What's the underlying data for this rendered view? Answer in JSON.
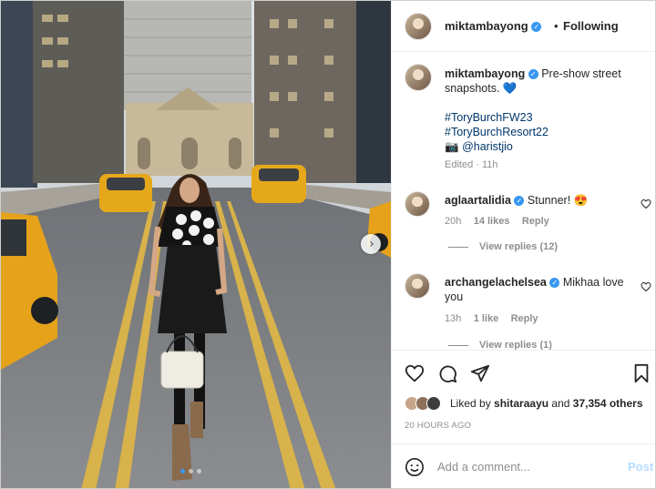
{
  "post": {
    "username": "miktambayong",
    "follow_status": "Following",
    "separator": "•",
    "caption": {
      "text": "Pre-show street snapshots. 💙",
      "hashtags": [
        "#ToryBurchFW23",
        "#ToryBurchResort22"
      ],
      "credit_prefix": "📷",
      "credit": "@haristjio",
      "edited": "Edited · 11h"
    },
    "comments": [
      {
        "username": "aglaartalidia",
        "text": "Stunner! 😍",
        "age": "20h",
        "likes": "14 likes",
        "reply_label": "Reply",
        "view_replies": "View replies (12)"
      },
      {
        "username": "archangelachelsea",
        "text": "Mikhaa love you",
        "age": "13h",
        "likes": "1 like",
        "reply_label": "Reply",
        "view_replies": "View replies (1)"
      }
    ],
    "likes_summary": {
      "prefix": "Liked by",
      "user": "shitaraayu",
      "middle": "and",
      "count": "37,354 others"
    },
    "time_ago": "20 HOURS AGO",
    "add_comment_placeholder": "Add a comment...",
    "post_button": "Post"
  },
  "icons": {
    "verified": "verified-badge-icon",
    "heart": "heart-icon",
    "comment": "comment-icon",
    "share": "share-icon",
    "save": "bookmark-icon",
    "emoji": "emoji-icon",
    "next": "chevron-right-icon"
  },
  "colors": {
    "verified": "#3897f0",
    "link": "#00376b",
    "muted": "#8e8e8e",
    "post_disabled": "#b3dbff"
  },
  "carousel": {
    "slides": 3,
    "active_index": 1
  }
}
